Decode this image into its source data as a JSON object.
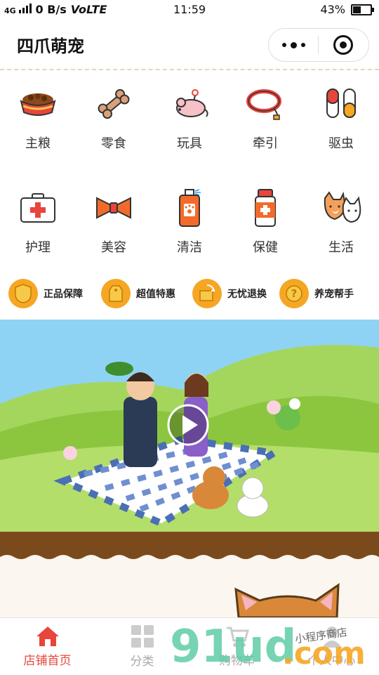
{
  "status_bar": {
    "network": "4G",
    "speed": "0 B/s",
    "volte": "VoLTE",
    "time": "11:59",
    "battery": "43%"
  },
  "header": {
    "title": "四爪萌宠"
  },
  "categories": [
    {
      "label": "主粮",
      "icon": "pet-food-bowl-icon"
    },
    {
      "label": "零食",
      "icon": "bone-icon"
    },
    {
      "label": "玩具",
      "icon": "toy-mouse-icon"
    },
    {
      "label": "牵引",
      "icon": "leash-icon"
    },
    {
      "label": "驱虫",
      "icon": "capsule-icon"
    },
    {
      "label": "护理",
      "icon": "first-aid-kit-icon"
    },
    {
      "label": "美容",
      "icon": "bow-tie-icon"
    },
    {
      "label": "清洁",
      "icon": "spray-bottle-icon"
    },
    {
      "label": "保健",
      "icon": "medicine-bottle-icon"
    },
    {
      "label": "生活",
      "icon": "cat-dog-icon"
    }
  ],
  "features": [
    {
      "label": "正品保障",
      "icon": "shield-icon"
    },
    {
      "label": "超值特惠",
      "icon": "price-tag-icon"
    },
    {
      "label": "无忧退换",
      "icon": "return-box-icon"
    },
    {
      "label": "养宠帮手",
      "icon": "help-icon"
    }
  ],
  "tabbar": [
    {
      "label": "店铺首页",
      "icon": "home-icon",
      "active": true
    },
    {
      "label": "分类",
      "icon": "grid-icon",
      "active": false
    },
    {
      "label": "购物车",
      "icon": "cart-icon",
      "active": false
    },
    {
      "label": "个人中心",
      "icon": "user-icon",
      "active": false
    }
  ],
  "watermark": {
    "brand": "91ud",
    "domain": ".com",
    "slogan": "小程序商店"
  },
  "colors": {
    "accent": "#f5a623",
    "active_tab": "#e8453c",
    "sky": "#8fd3f4",
    "grass": "#8cc63f",
    "soil": "#7a4a1c"
  }
}
